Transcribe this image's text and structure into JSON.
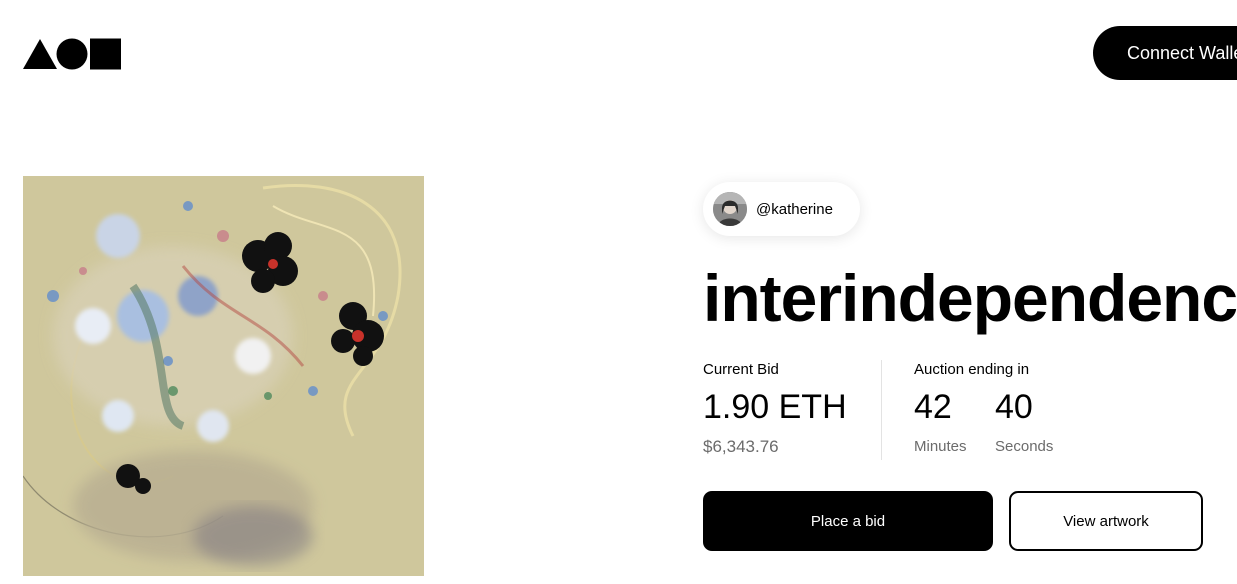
{
  "header": {
    "logo_icon": "triangle-circle-square-logo",
    "connect_label": "Connect Wallet"
  },
  "artwork": {
    "icon": "abstract-floral-artwork",
    "background_color": "#cfc79c"
  },
  "creator": {
    "handle": "@katherine",
    "avatar_icon": "user-avatar"
  },
  "auction": {
    "title": "interindependence",
    "current_bid_label": "Current Bid",
    "current_bid_value": "1.90 ETH",
    "current_bid_usd": "$6,343.76",
    "ending_label": "Auction ending in",
    "minutes_value": "42",
    "minutes_label": "Minutes",
    "seconds_value": "40",
    "seconds_label": "Seconds"
  },
  "actions": {
    "place_bid_label": "Place a bid",
    "view_artwork_label": "View artwork"
  },
  "colors": {
    "primary": "#000000",
    "muted_text": "#6b6b6b",
    "background": "#ffffff"
  }
}
